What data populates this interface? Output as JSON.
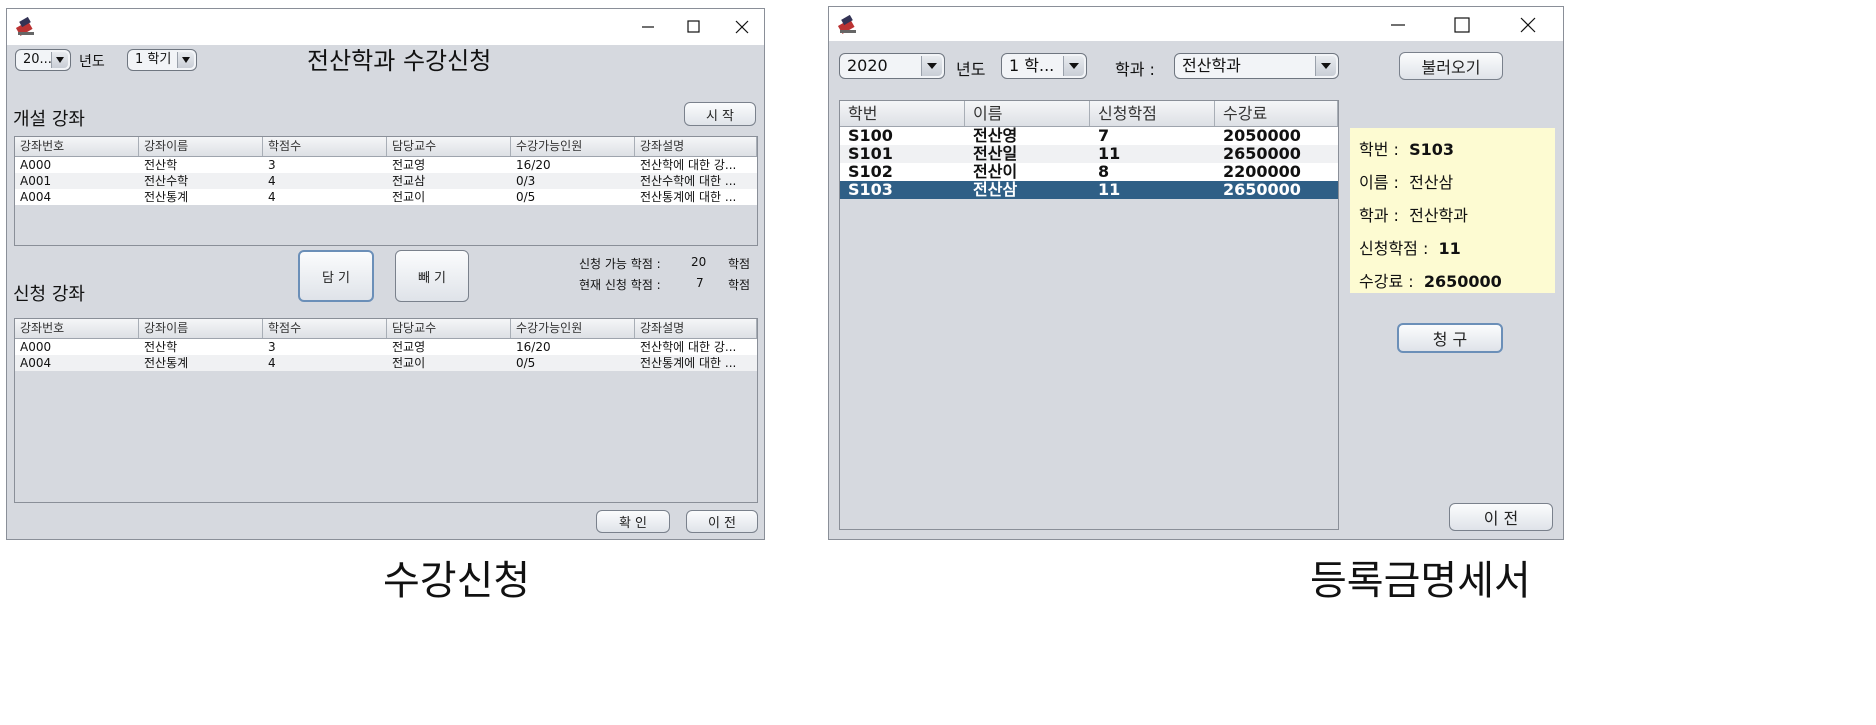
{
  "enroll_window": {
    "year_combo": "20...",
    "year_label": "년도",
    "term_combo": "1 학기",
    "title": "전산학과 수강신청",
    "opened_section_label": "개설 강좌",
    "start_button": "시 작",
    "columns": [
      "강좌번호",
      "강좌이름",
      "학점수",
      "담당교수",
      "수강가능인원",
      "강좌설명"
    ],
    "opened_rows": [
      [
        "A000",
        "전산학",
        "3",
        "전교영",
        "16/20",
        "전산학에 대한 강..."
      ],
      [
        "A001",
        "전산수학",
        "4",
        "전교삼",
        "0/3",
        "전산수학에 대한 ..."
      ],
      [
        "A004",
        "전산통계",
        "4",
        "전교이",
        "0/5",
        "전산통계에 대한 ..."
      ]
    ],
    "add_button": "담 기",
    "remove_button": "빼 기",
    "available_credits_label": "신청 가능 학점 :",
    "available_credits_value": "20",
    "current_credits_label": "현재 신청 학점 :",
    "current_credits_value": "7",
    "credit_unit": "학점",
    "applied_section_label": "신청 강좌",
    "applied_rows": [
      [
        "A000",
        "전산학",
        "3",
        "전교영",
        "16/20",
        "전산학에 대한 강..."
      ],
      [
        "A004",
        "전산통계",
        "4",
        "전교이",
        "0/5",
        "전산통계에 대한 ..."
      ]
    ],
    "confirm_button": "확 인",
    "prev_button": "이 전"
  },
  "tuition_window": {
    "year_combo": "2020",
    "year_label": "년도",
    "term_combo": "1 학...",
    "dept_label": "학과 :",
    "dept_combo": "전산학과",
    "load_button": "불러오기",
    "columns": [
      "학번",
      "이름",
      "신청학점",
      "수강료"
    ],
    "rows": [
      [
        "S100",
        "전산영",
        "7",
        "2050000"
      ],
      [
        "S101",
        "전산일",
        "11",
        "2650000"
      ],
      [
        "S102",
        "전산이",
        "8",
        "2200000"
      ],
      [
        "S103",
        "전산삼",
        "11",
        "2650000"
      ]
    ],
    "selected_row": 3,
    "info": {
      "id_label": "학번 :",
      "id_value": "S103",
      "name_label": "이름 :",
      "name_value": "전산삼",
      "dept_label": "학과 :",
      "dept_value": "전산학과",
      "credits_label": "신청학점 :",
      "credits_value": "11",
      "fee_label": "수강료 :",
      "fee_value": "2650000"
    },
    "bill_button": "청 구",
    "prev_button": "이 전"
  },
  "captions": {
    "left": "수강신청",
    "right": "등록금명세서"
  },
  "colors": {
    "window_bg": "#d6d9df",
    "selected_row": "#2f5f86",
    "info_panel": "#fdfbd2"
  }
}
